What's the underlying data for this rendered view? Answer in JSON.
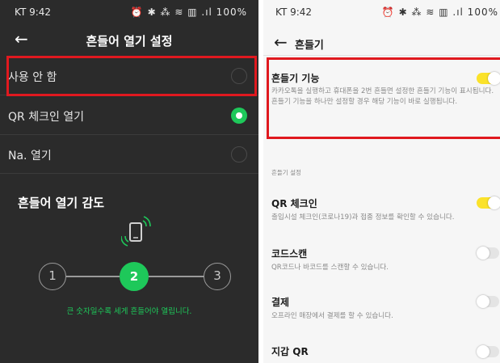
{
  "left_screen": {
    "status_bar": {
      "time": "KT 9:42",
      "notif_icons": "■ ● ◉ ●",
      "right_icons": "⏰ ✱ ⁂ ≋ ▥ .ıl 100%",
      "battery_pct": "100%"
    },
    "header": {
      "back": "←",
      "title": "흔들어 열기 설정"
    },
    "options": [
      {
        "label": "사용 안 함",
        "selected": false,
        "highlighted": true
      },
      {
        "label": "QR 체크인 열기",
        "selected": true,
        "highlighted": false
      },
      {
        "label": "Na. 열기",
        "selected": false,
        "highlighted": false
      }
    ],
    "sensitivity": {
      "title": "흔들어 열기 감도",
      "levels": [
        "1",
        "2",
        "3"
      ],
      "selected_level": "2",
      "hint": "큰 숫자일수록 세게 흔들어야 열립니다."
    },
    "colors": {
      "background": "#2b2b2b",
      "accent": "#1ec85a",
      "highlight": "#e0191f"
    }
  },
  "right_screen": {
    "status_bar": {
      "time": "KT 9:42",
      "notif_icons": "■ ● ◉ ●",
      "right_icons": "⏰ ✱ ⁂ ≋ ▥ .ıl 100%",
      "battery_pct": "100%"
    },
    "header": {
      "back": "←",
      "title": "흔들기"
    },
    "shake_feature": {
      "title": "흔들기 기능",
      "description": "카카오톡을 실행하고 휴대폰을 2번 흔들면 설정한 흔들기 기능이 표시됩니다. 흔들기 기능을 하나만 설정할 경우 해당 기능이 바로 실행됩니다.",
      "enabled": true
    },
    "section_title": "흔들기 설정",
    "items": [
      {
        "title": "QR 체크인",
        "description": "출입시설 체크인(코로나19)과 접종 정보를 확인할 수 있습니다.",
        "enabled": true
      },
      {
        "title": "코드스캔",
        "description": "QR코드나 바코드를 스캔할 수 있습니다.",
        "enabled": false
      },
      {
        "title": "결제",
        "description": "오프라인 매장에서 결제를 할 수 있습니다.",
        "enabled": false
      },
      {
        "title": "지갑 QR",
        "description": "",
        "enabled": false
      }
    ],
    "colors": {
      "background": "#f6f6f6",
      "toggle_on": "#fbe22a",
      "highlight": "#e0191f"
    }
  }
}
